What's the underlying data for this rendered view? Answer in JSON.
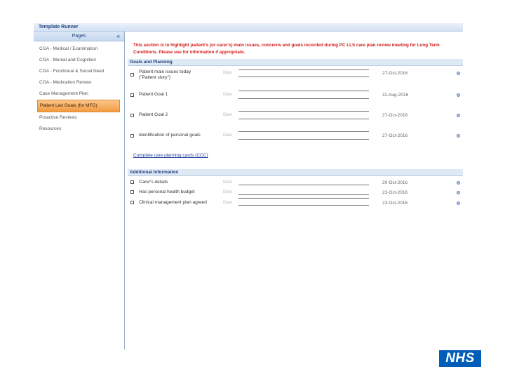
{
  "app": {
    "title": "Template Runner"
  },
  "sidebar": {
    "header": "Pages",
    "collapse_icon": "«",
    "items": [
      {
        "label": "CGA - Medical / Examination"
      },
      {
        "label": "CGA - Mental and Cognition"
      },
      {
        "label": "CGA - Functional & Social Need"
      },
      {
        "label": "CGA - Medication Review"
      },
      {
        "label": "Case Management Plan"
      },
      {
        "label": "Patient Led Goals (for MFG)",
        "active": true
      },
      {
        "label": "Proactive Reviews"
      },
      {
        "label": "Resources"
      }
    ]
  },
  "main": {
    "notice": "This section is to highlight patient's (or carer's) main issues, concerns and goals recorded during PC LLS care plan review meeting for Long Term Conditions. Please use for information if appropriate.",
    "goals_section": {
      "title": "Goals and Planning",
      "rows": [
        {
          "label": "Patient main issues today (\"Patient story\")",
          "date_label": "Date",
          "date": "27-Oct-2016"
        },
        {
          "label": "Patient Goal 1",
          "date_label": "Date",
          "date": "11-Aug-2016"
        },
        {
          "label": "Patient Goal 2",
          "date_label": "Date",
          "date": "27-Oct-2016"
        },
        {
          "label": "Identification of personal goals",
          "date_label": "Date",
          "date": "27-Oct-2016"
        }
      ]
    },
    "link_text": "Complete care planning cards (CCC)",
    "additional_section": {
      "title": "Additional Information",
      "rows": [
        {
          "label": "Carer's details",
          "date_label": "Date",
          "date": "20-Oct-2016"
        },
        {
          "label": "Has personal health budget",
          "date_label": "Date",
          "date": "23-Oct-2016"
        },
        {
          "label": "Clinical management plan agreed",
          "date_label": "Date",
          "date": "23-Oct-2016"
        }
      ]
    }
  },
  "logo": {
    "text": "NHS",
    "color": "#005eb8"
  },
  "colors": {
    "notice": "#d21a1a",
    "active_nav": "#f29b42",
    "header_blue": "#1f3f7a"
  }
}
